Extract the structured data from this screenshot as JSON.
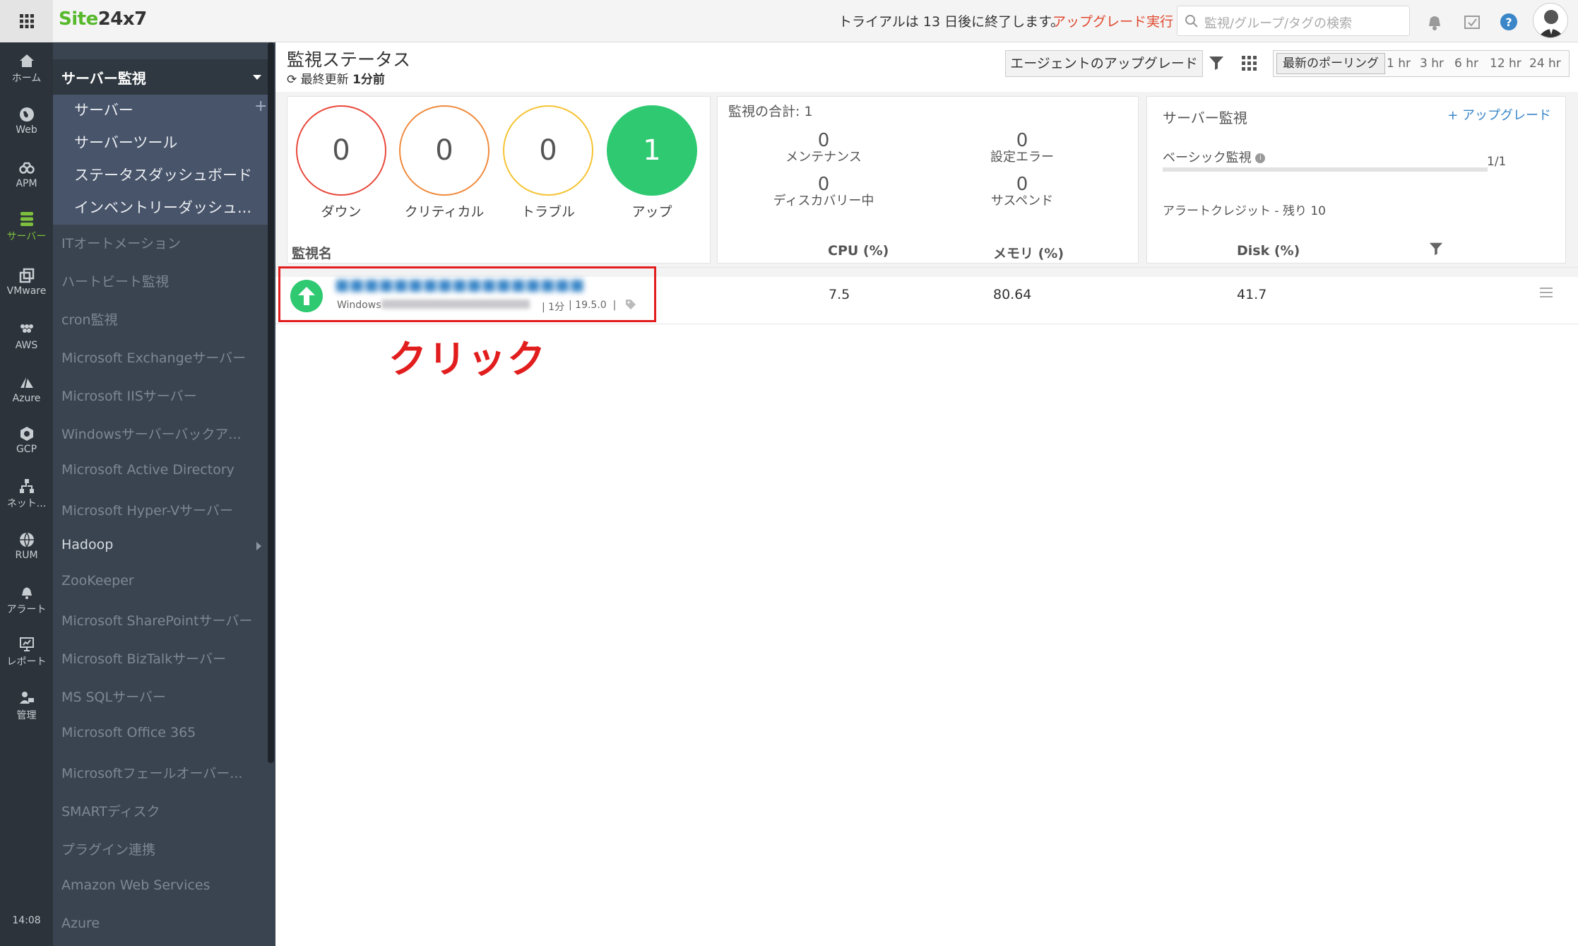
{
  "brand": {
    "logo_green": "Site",
    "logo_dark": "24x7"
  },
  "header": {
    "trial_text": "トライアルは 13 日後に終了します。",
    "upgrade_link": "アップグレード実行",
    "search_placeholder": "監視/グループ/タグの検索"
  },
  "left_nav": {
    "items": [
      {
        "label": "ホーム",
        "icon": "home-icon"
      },
      {
        "label": "Web",
        "icon": "globe-icon"
      },
      {
        "label": "APM",
        "icon": "binoculars-icon"
      },
      {
        "label": "サーバー",
        "icon": "server-icon",
        "active": true
      },
      {
        "label": "VMware",
        "icon": "vmware-icon"
      },
      {
        "label": "AWS",
        "icon": "aws-icon"
      },
      {
        "label": "Azure",
        "icon": "azure-icon"
      },
      {
        "label": "GCP",
        "icon": "gcp-icon"
      },
      {
        "label": "ネット...",
        "icon": "network-icon"
      },
      {
        "label": "RUM",
        "icon": "rum-icon"
      },
      {
        "label": "アラート",
        "icon": "bell-icon"
      },
      {
        "label": "レポート",
        "icon": "report-icon"
      },
      {
        "label": "管理",
        "icon": "admin-icon"
      }
    ],
    "clock": "14:08"
  },
  "sidebar": {
    "header": "サーバー監視",
    "sub_items": [
      "サーバー",
      "サーバーツール",
      "ステータスダッシュボード",
      "インベントリーダッシュ..."
    ],
    "categories": [
      "ITオートメーション",
      "ハートビート監視",
      "cron監視",
      "Microsoft Exchangeサーバー",
      "Microsoft IISサーバー",
      "Windowsサーバーバックア...",
      "Microsoft Active Directory",
      "Microsoft Hyper-Vサーバー",
      "Hadoop",
      "ZooKeeper",
      "Microsoft SharePointサーバー",
      "Microsoft BizTalkサーバー",
      "MS SQLサーバー",
      "Microsoft Office 365",
      "Microsoftフェールオーバー...",
      "SMARTディスク",
      "プラグイン連携",
      "Amazon Web Services",
      "Azure"
    ]
  },
  "main": {
    "title": "監視ステータス",
    "refresh_label": "最終更新",
    "refresh_value": "1分前",
    "agent_upgrade_button": "エージェントのアップグレード",
    "polling": {
      "latest": "最新のポーリング",
      "ranges": [
        "1 hr",
        "3 hr",
        "6 hr",
        "12 hr",
        "24 hr"
      ]
    }
  },
  "status": {
    "down": {
      "count": "0",
      "label": "ダウン",
      "color": "#e8473a"
    },
    "critical": {
      "count": "0",
      "label": "クリティカル",
      "color": "#f08a3c"
    },
    "trouble": {
      "count": "0",
      "label": "トラブル",
      "color": "#f5c331"
    },
    "up": {
      "count": "1",
      "label": "アップ",
      "color": "#2ec971"
    }
  },
  "totals": {
    "title": "監視の合計: 1",
    "maintenance": {
      "count": "0",
      "label": "メンテナンス"
    },
    "config_error": {
      "count": "0",
      "label": "設定エラー"
    },
    "discovery": {
      "count": "0",
      "label": "ディスカバリー中"
    },
    "suspended": {
      "count": "0",
      "label": "サスペンド"
    }
  },
  "license": {
    "title": "サーバー監視",
    "upgrade": "+ アップグレード",
    "basic": "ベーシック監視",
    "count": "1/1",
    "used_fraction": 1.0,
    "credit": "アラートクレジット - 残り 10"
  },
  "table": {
    "headers": {
      "name": "監視名",
      "cpu": "CPU (%)",
      "memory": "メモリ (%)",
      "disk": "Disk (%)"
    },
    "rows": [
      {
        "name": "■■■■■■■■■■■■■■■■■",
        "os": "Windows",
        "poll": "1分",
        "version": "19.5.0",
        "cpu": "7.5",
        "memory": "80.64",
        "disk": "41.7"
      }
    ]
  },
  "annotation": {
    "label": "クリック"
  }
}
